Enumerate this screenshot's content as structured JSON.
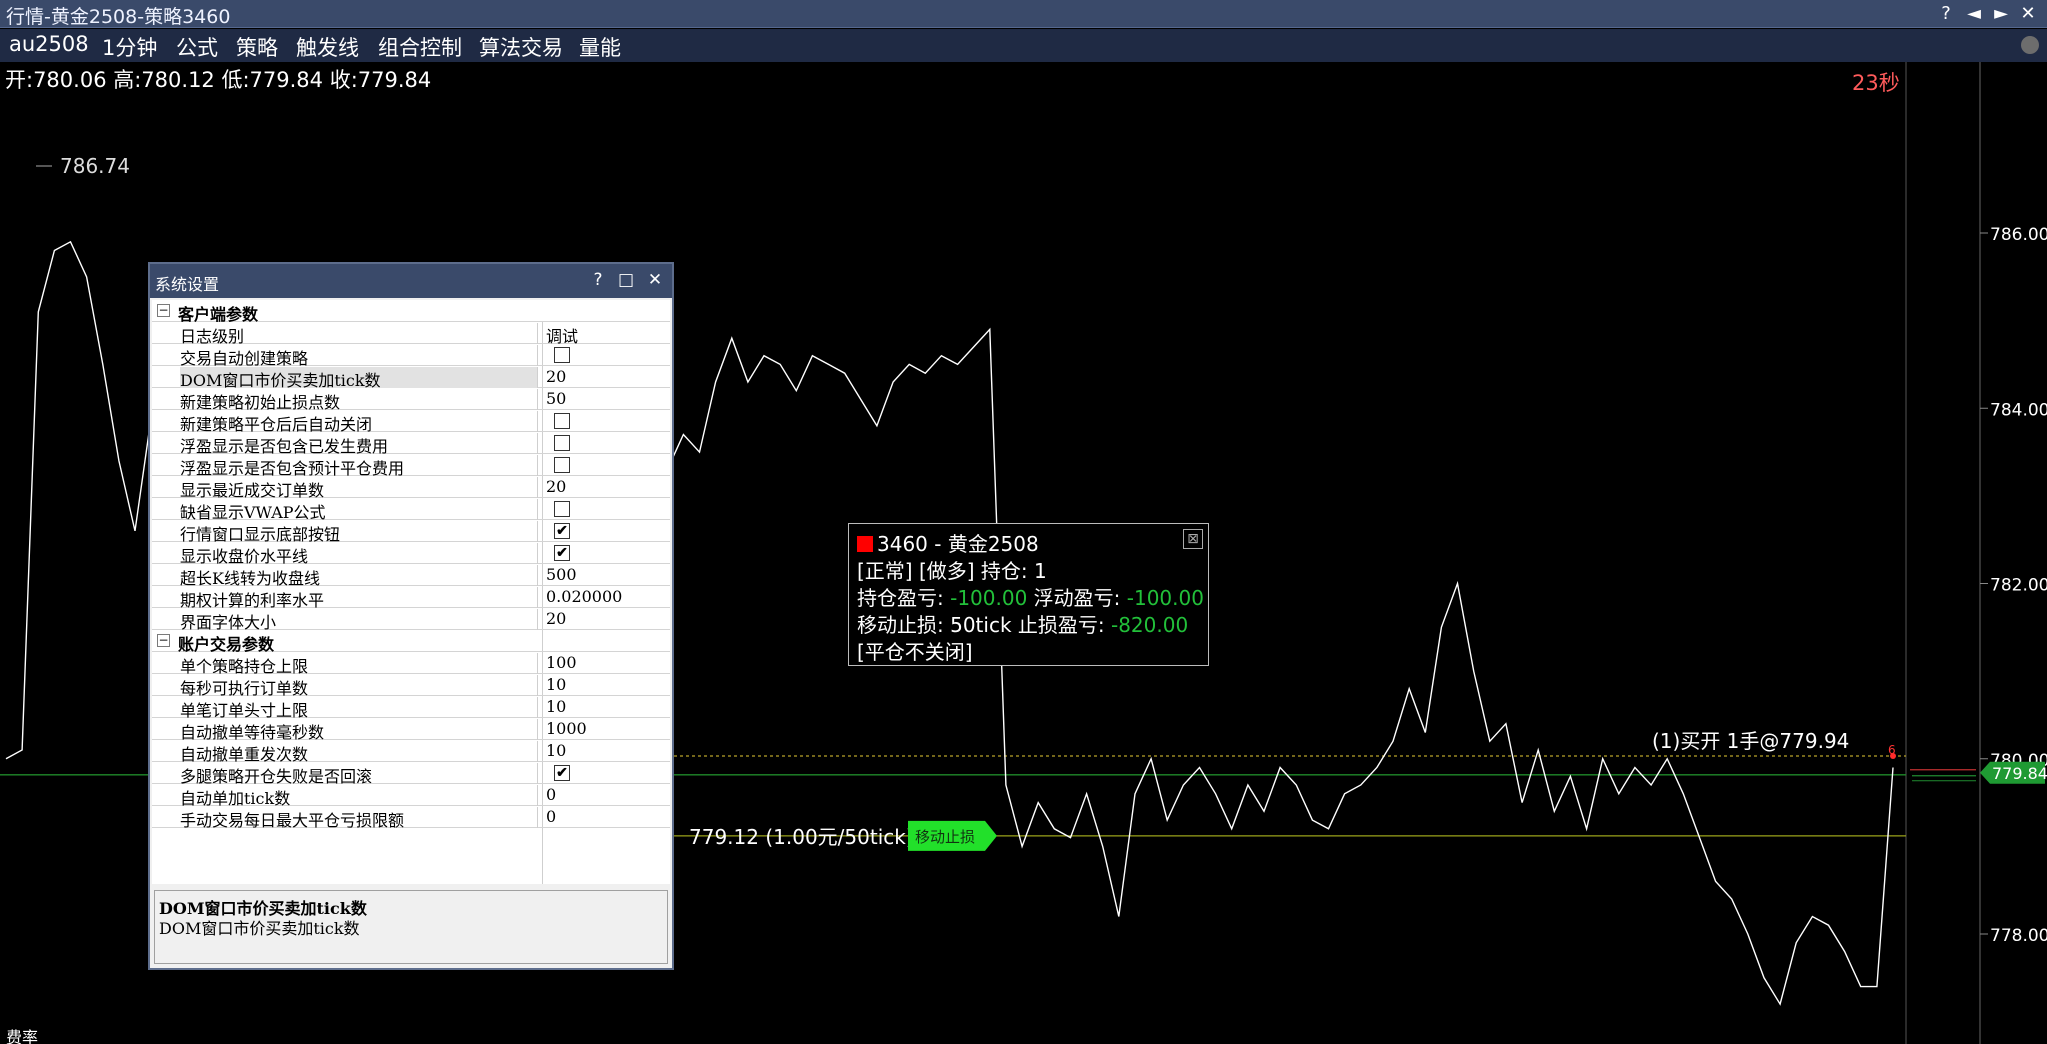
{
  "window": {
    "title": "行情-黄金2508-策略3460",
    "help_btn": "?",
    "prev_btn": "◄",
    "next_btn": "►",
    "close_btn": "✕"
  },
  "menu": {
    "items": [
      "au2508",
      "1分钟",
      "公式",
      "策略",
      "触发线",
      "组合控制",
      "算法交易",
      "量能"
    ]
  },
  "ohlc": {
    "text": "开:780.06 高:780.12 低:779.84 收:779.84"
  },
  "countdown": "23秒",
  "fee_label": "费率",
  "chart_data": {
    "type": "line",
    "yticks": [
      "786.00",
      "784.00",
      "782.00",
      "780.00",
      "778.00"
    ],
    "ytick_values": [
      786.0,
      784.0,
      782.0,
      780.0,
      778.0
    ],
    "ylim": [
      777.0,
      787.0
    ],
    "high_marker": "786.74",
    "high_value": 786.74,
    "current_price_label": "779.84",
    "current_price": 779.84,
    "open_price": 779.94,
    "stop_price": 779.12,
    "stop_label": "779.12 (1.00元/50tick)",
    "stop_button": "移动止损",
    "trade_label": "(1)买开 1手@779.94",
    "trade_marker": "6",
    "series": [
      {
        "values": [
          780.0,
          780.1,
          785.1,
          785.8,
          785.9,
          785.5,
          784.5,
          783.4,
          782.6,
          783.9,
          783.1,
          782.8,
          783.8,
          784.2,
          783.6,
          782.0,
          783.3,
          782.0,
          782.9,
          781.0,
          781.5,
          780.5,
          781.6,
          783.5,
          783.4,
          784.0,
          783.7,
          783.2,
          783.6,
          783.8,
          784.3,
          784.7,
          783.8,
          783.5,
          783.6,
          783.9,
          783.7,
          783.2,
          783.8,
          783.4,
          783.5,
          783.3,
          783.7,
          783.5,
          784.3,
          784.8,
          784.3,
          784.6,
          784.5,
          784.2,
          784.6,
          784.5,
          784.4,
          784.1,
          783.8,
          784.3,
          784.5,
          784.4,
          784.6,
          784.5,
          784.7,
          784.9,
          779.7,
          779.0,
          779.5,
          779.2,
          779.1,
          779.6,
          779.0,
          778.2,
          779.6,
          780.0,
          779.3,
          779.7,
          779.9,
          779.6,
          779.2,
          779.7,
          779.4,
          779.9,
          779.7,
          779.3,
          779.2,
          779.6,
          779.7,
          779.9,
          780.2,
          780.8,
          780.3,
          781.5,
          782.0,
          781.0,
          780.2,
          780.4,
          779.5,
          780.1,
          779.4,
          779.8,
          779.2,
          780.0,
          779.6,
          779.9,
          779.7,
          780.0,
          779.6,
          779.1,
          778.6,
          778.4,
          778.0,
          777.5,
          777.2,
          777.9,
          778.2,
          778.1,
          777.8,
          777.4,
          777.4,
          779.9
        ],
        "color": "#ffffff"
      }
    ]
  },
  "settings": {
    "title": "系统设置",
    "help_btn": "?",
    "max_btn": "□",
    "close_btn": "✕",
    "groups": [
      {
        "name": "客户端参数",
        "toggle": "−",
        "rows": [
          {
            "name": "日志级别",
            "value": "调试"
          },
          {
            "name": "交易自动创建策略",
            "checkbox": true,
            "checked": false
          },
          {
            "name": "DOM窗口市价买卖加tick数",
            "value": "20",
            "selected": true
          },
          {
            "name": "新建策略初始止损点数",
            "value": "50"
          },
          {
            "name": "新建策略平仓后后自动关闭",
            "checkbox": true,
            "checked": false
          },
          {
            "name": "浮盈显示是否包含已发生费用",
            "checkbox": true,
            "checked": false
          },
          {
            "name": "浮盈显示是否包含预计平仓费用",
            "checkbox": true,
            "checked": false
          },
          {
            "name": "显示最近成交订单数",
            "value": "20"
          },
          {
            "name": "缺省显示VWAP公式",
            "checkbox": true,
            "checked": false
          },
          {
            "name": "行情窗口显示底部按钮",
            "checkbox": true,
            "checked": true
          },
          {
            "name": "显示收盘价水平线",
            "checkbox": true,
            "checked": true
          },
          {
            "name": "超长K线转为收盘线",
            "value": "500"
          },
          {
            "name": "期权计算的利率水平",
            "value": "0.020000"
          },
          {
            "name": "界面字体大小",
            "value": "20"
          }
        ]
      },
      {
        "name": "账户交易参数",
        "toggle": "−",
        "rows": [
          {
            "name": "单个策略持仓上限",
            "value": "100"
          },
          {
            "name": "每秒可执行订单数",
            "value": "10"
          },
          {
            "name": "单笔订单头寸上限",
            "value": "10"
          },
          {
            "name": "自动撤单等待毫秒数",
            "value": "1000"
          },
          {
            "name": "自动撤单重发次数",
            "value": "10"
          },
          {
            "name": "多腿策略开仓失败是否回滚",
            "checkbox": true,
            "checked": true
          },
          {
            "name": "自动单加tick数",
            "value": "0"
          },
          {
            "name": "手动交易每日最大平仓亏损限额",
            "value": "0"
          }
        ]
      }
    ],
    "description_title": "DOM窗口市价买卖加tick数",
    "description_text": "DOM窗口市价买卖加tick数",
    "check_mark": "✔"
  },
  "strategy_box": {
    "header": "3460 - 黄金2508",
    "close_icon": "⊠",
    "line2": "[正常] [做多] 持仓: 1",
    "pos_pl_label": "持仓盈亏: ",
    "pos_pl_value": "-100.00",
    "float_pl_label": " 浮动盈亏: ",
    "float_pl_value": "-100.00",
    "stop_label": "移动止损: 50tick 止损盈亏: ",
    "stop_value": "-820.00",
    "line5": "[平仓不关闭]"
  }
}
